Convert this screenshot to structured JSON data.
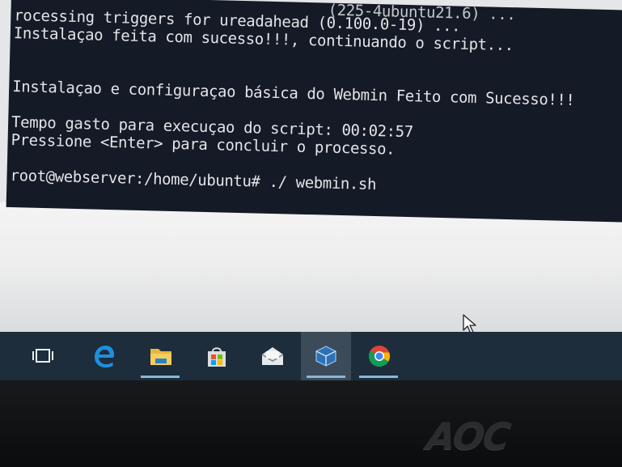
{
  "terminal": {
    "lines": [
      "rocessing triggers for ureadahead (0.100.0-19) ...",
      "Instalaçao feita com sucesso!!!, continuando o script...",
      "",
      "",
      "Instalaçao e configuraçao básica do Webmin Feito com Sucesso!!!",
      "",
      "Tempo gasto para execuçao do script: 00:02:57",
      "Pressione <Enter> para concluir o processo.",
      "",
      "root@webserver:/home/ubuntu# ./ webmin.sh"
    ],
    "partial_top_line": "(225-4ubuntu21.6) ..."
  },
  "taskbar": {
    "items": [
      {
        "icon": "task-view-icon"
      },
      {
        "icon": "edge-browser-icon"
      },
      {
        "icon": "file-explorer-icon",
        "state": "running"
      },
      {
        "icon": "microsoft-store-icon"
      },
      {
        "icon": "mail-icon"
      },
      {
        "icon": "virtualbox-icon",
        "state": "active"
      },
      {
        "icon": "chrome-icon",
        "state": "running"
      }
    ],
    "colors": {
      "taskbar": "#1d2d3c",
      "running_indicator": "#8ab6d8",
      "terminal_bg": "#141a26",
      "terminal_fg": "#e4e4e8"
    }
  },
  "monitor": {
    "brand": "AOC"
  }
}
